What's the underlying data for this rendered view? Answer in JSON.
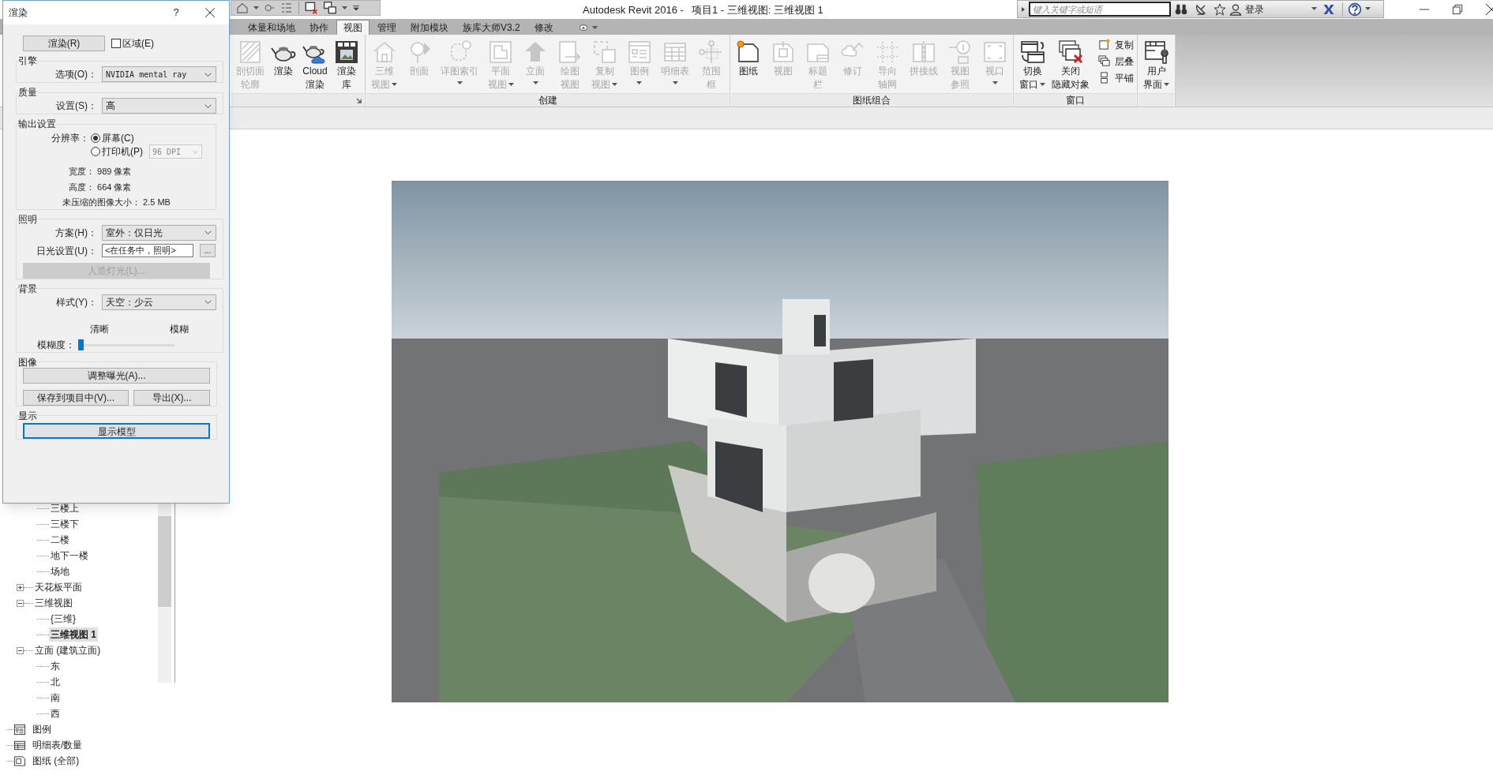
{
  "title_bar": {
    "app": "Autodesk Revit 2016 -",
    "document": "项目1 - 三维视图: 三维视图 1"
  },
  "info_center": {
    "search_placeholder": "键入关键字或短语",
    "sign_in": "登录"
  },
  "ribbon_tabs": [
    {
      "label": "体量和场地",
      "selected": false
    },
    {
      "label": "协作",
      "selected": false
    },
    {
      "label": "视图",
      "selected": true
    },
    {
      "label": "管理",
      "selected": false
    },
    {
      "label": "附加模块",
      "selected": false
    },
    {
      "label": "族库大师V3.2",
      "selected": false
    },
    {
      "label": "修改",
      "selected": false
    }
  ],
  "ribbon": {
    "panels": [
      {
        "dialog_launcher": true,
        "buttons": [
          {
            "lines": [
              "剖切面",
              "轮廓"
            ],
            "disabled": true,
            "dropdown": false
          },
          {
            "lines": [
              "渲染"
            ],
            "disabled": false,
            "dropdown": false
          },
          {
            "lines": [
              "Cloud",
              "渲染"
            ],
            "disabled": false,
            "dropdown": false
          },
          {
            "lines": [
              "渲染",
              "库"
            ],
            "disabled": false,
            "dropdown": false
          }
        ]
      },
      {
        "title": "创建",
        "dialog_launcher": false,
        "buttons": [
          {
            "lines": [
              "三维",
              "视图"
            ],
            "disabled": true,
            "dropdown": true
          },
          {
            "lines": [
              "剖面"
            ],
            "disabled": true,
            "dropdown": false
          },
          {
            "lines": [
              "详图索引"
            ],
            "disabled": true,
            "dropdown": true
          },
          {
            "lines": [
              "平面",
              "视图"
            ],
            "disabled": true,
            "dropdown": true
          },
          {
            "lines": [
              "立面"
            ],
            "disabled": true,
            "dropdown": true
          },
          {
            "lines": [
              "绘图",
              "视图"
            ],
            "disabled": true,
            "dropdown": false
          },
          {
            "lines": [
              "复制",
              "视图"
            ],
            "disabled": true,
            "dropdown": true
          },
          {
            "lines": [
              "图例"
            ],
            "disabled": true,
            "dropdown": true
          },
          {
            "lines": [
              "明细表"
            ],
            "disabled": true,
            "dropdown": true
          },
          {
            "lines": [
              "范围",
              "框"
            ],
            "disabled": true,
            "dropdown": false
          }
        ]
      },
      {
        "title": "图纸组合",
        "dialog_launcher": false,
        "buttons": [
          {
            "lines": [
              "图纸"
            ],
            "disabled": false,
            "dropdown": false
          },
          {
            "lines": [
              "视图"
            ],
            "disabled": true,
            "dropdown": false
          },
          {
            "lines": [
              "标题",
              "栏"
            ],
            "disabled": true,
            "dropdown": false
          },
          {
            "lines": [
              "修订"
            ],
            "disabled": true,
            "dropdown": false
          },
          {
            "lines": [
              "导向",
              "轴网"
            ],
            "disabled": true,
            "dropdown": false
          },
          {
            "lines": [
              "拼接线"
            ],
            "disabled": true,
            "dropdown": false
          },
          {
            "lines": [
              "视图",
              "参照"
            ],
            "disabled": true,
            "dropdown": false
          },
          {
            "lines": [
              "视口"
            ],
            "disabled": true,
            "dropdown": true
          }
        ]
      },
      {
        "title": "窗口",
        "dialog_launcher": false,
        "buttons": [
          {
            "lines": [
              "切换",
              "窗口"
            ],
            "disabled": false,
            "dropdown": true
          },
          {
            "lines": [
              "关闭",
              "隐藏对象"
            ],
            "disabled": false,
            "dropdown": false
          }
        ],
        "small_buttons": [
          {
            "label": "复制"
          },
          {
            "label": "层叠"
          },
          {
            "label": "平铺"
          }
        ]
      },
      {
        "dialog_launcher": false,
        "buttons": [
          {
            "lines": [
              "用户",
              "界面"
            ],
            "disabled": false,
            "dropdown": true
          }
        ]
      }
    ]
  },
  "project_browser": {
    "items": [
      {
        "children": [
          {
            "children": [
              {
                "label": "三楼上",
                "selected": false
              },
              {
                "label": "三楼下",
                "selected": false
              },
              {
                "label": "二楼",
                "selected": false
              },
              {
                "label": "地下一楼",
                "selected": false
              },
              {
                "label": "场地",
                "selected": false
              }
            ]
          },
          {
            "label": "天花板平面",
            "selected": false,
            "expanded": false
          },
          {
            "label": "三维视图",
            "selected": false,
            "expanded": true,
            "children": [
              {
                "label": "{三维}",
                "selected": false
              },
              {
                "label": "三维视图 1",
                "selected": true
              }
            ]
          },
          {
            "label": "立面 (建筑立面)",
            "selected": false,
            "expanded": true,
            "children": [
              {
                "label": "东",
                "selected": false
              },
              {
                "label": "北",
                "selected": false
              },
              {
                "label": "南",
                "selected": false
              },
              {
                "label": "西",
                "selected": false
              }
            ]
          }
        ]
      },
      {
        "label": "图例",
        "selected": false
      },
      {
        "label": "明细表/数量",
        "selected": false
      },
      {
        "label": "图纸 (全部)",
        "selected": false
      }
    ]
  },
  "render_dialog": {
    "title": "渲染",
    "help": "?",
    "render_button": "渲染(R)",
    "region": {
      "label": "区域(E)",
      "checked": false
    },
    "engine": {
      "title": "引擎",
      "option_label": "选项(O)：",
      "option_value": "NVIDIA mental ray"
    },
    "quality": {
      "title": "质量",
      "setting_label": "设置(S)：",
      "setting_value": "高"
    },
    "output": {
      "title": "输出设置",
      "resolution_label": "分辨率：",
      "resolutions": [
        {
          "label": "屏幕(C)",
          "selected": true
        },
        {
          "label": "打印机(P)",
          "selected": false
        }
      ],
      "dpi": {
        "value": "96 DPI",
        "disabled": true
      },
      "width": "宽度： 989 像素",
      "height": "高度： 664 像素",
      "size": "未压缩的图像大小： 2.5 MB"
    },
    "lighting": {
      "title": "照明",
      "scheme_label": "方案(H)：",
      "scheme_value": "室外：仅日光",
      "sun_label": "日光设置(U)：",
      "sun_value": "<在任务中，照明>",
      "sun_button": "...",
      "artificial_button": {
        "label": "人造灯光(L)...",
        "disabled": true
      }
    },
    "background": {
      "title": "背景",
      "style_label": "样式(Y)：",
      "style_value": "天空：少云",
      "clear_label": "清晰",
      "blur_label": "模糊",
      "blur_level_label": "模糊度：",
      "blur": {
        "level": 0
      }
    },
    "image": {
      "title": "图像",
      "adjust_button": "调整曝光(A)...",
      "save_button": "保存到项目中(V)...",
      "export_button": "导出(X)..."
    },
    "display": {
      "title": "显示",
      "show_model_button": "显示模型"
    }
  }
}
